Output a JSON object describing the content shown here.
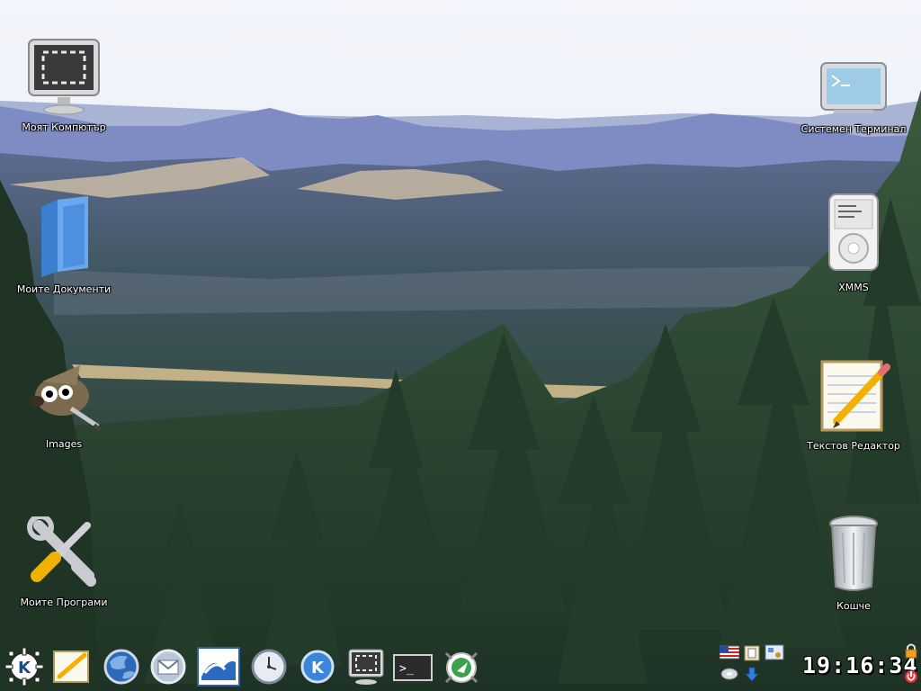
{
  "desktop_icons": [
    {
      "label": "Моят Компютър",
      "icon": "computer-icon"
    },
    {
      "label": "Моите Документи",
      "icon": "folder-icon"
    },
    {
      "label": "Images",
      "icon": "gimp-icon"
    },
    {
      "label": "Моите Програми",
      "icon": "tools-icon"
    },
    {
      "label": "Системен Терминал",
      "icon": "terminal-icon"
    },
    {
      "label": "XMMS",
      "icon": "media-player-icon"
    },
    {
      "label": "Текстов Редактор",
      "icon": "text-editor-icon"
    },
    {
      "label": "Кошче",
      "icon": "trash-icon"
    }
  ],
  "taskbar": {
    "launchers": [
      {
        "name": "kde-menu"
      },
      {
        "name": "text-editor"
      },
      {
        "name": "web-browser"
      },
      {
        "name": "email-client"
      },
      {
        "name": "office-suite"
      },
      {
        "name": "system-clock"
      },
      {
        "name": "konqueror"
      },
      {
        "name": "desktop"
      },
      {
        "name": "terminal"
      },
      {
        "name": "network"
      }
    ],
    "clock": "19:16:34"
  },
  "colors": {
    "sky": "#dfe6f2",
    "mountains": "#7f8cc4",
    "forest": "#2f4a35",
    "clock_text": "#ffffff"
  }
}
